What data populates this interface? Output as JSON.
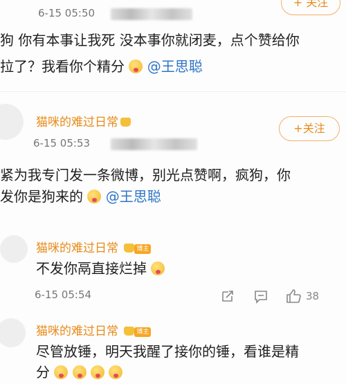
{
  "comment1": {
    "time": "6-15 05:50",
    "follow": "+ 关注",
    "line1": "狗 你有本事让我死 没本事你就闭麦，点个赞给你",
    "line2": "拉了？我看你个精分",
    "mention": "@王思聪"
  },
  "comment2": {
    "username": "猫咪的难过日常",
    "time": "6-15 05:53",
    "follow": "+关注",
    "line1": "紧为我专门发一条微博，别光点赞啊，疯狗，你",
    "line2": "发你是狗来的",
    "mention": "@王思聪"
  },
  "reply1": {
    "username": "猫咪的难过日常",
    "badge": "博主",
    "text": "不发你鬲直接烂掉",
    "time": "6-15 05:54",
    "likes": "38"
  },
  "reply2": {
    "username": "猫咪的难过日常",
    "badge": "博主",
    "line1": "尽管放锤，明天我醒了接你的锤，看谁是精",
    "line2": "分"
  },
  "icons": [
    "share-icon",
    "comment-icon",
    "like-icon",
    "emoji-icon",
    "crown-icon"
  ]
}
